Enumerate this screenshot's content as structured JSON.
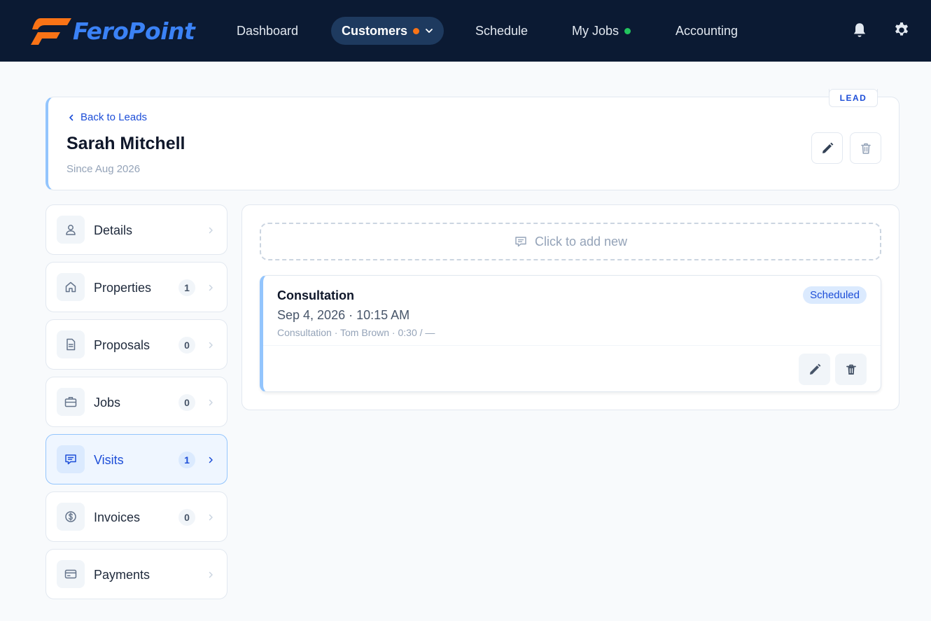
{
  "app": {
    "brand": "FeroPoint",
    "brand_colors": {
      "orange": "#f97316",
      "blue": "#3b82f6",
      "nav_bg": "#0b1a33"
    }
  },
  "nav": {
    "items": [
      {
        "label": "Dashboard",
        "active": false
      },
      {
        "label": "Customers",
        "active": true,
        "dot_color": "#f97316",
        "has_dropdown": true
      },
      {
        "label": "Schedule",
        "active": false
      },
      {
        "label": "My Jobs",
        "active": false,
        "dot_color": "#22c55e"
      },
      {
        "label": "Accounting",
        "active": false
      }
    ],
    "icons": [
      "bell-icon",
      "gear-icon"
    ]
  },
  "header": {
    "back_label": "Back to Leads",
    "name": "Sarah Mitchell",
    "since": "Since Aug 2026",
    "badge": "LEAD"
  },
  "sidebar": {
    "items": [
      {
        "label": "Details",
        "icon": "user-icon",
        "count": null,
        "active": false
      },
      {
        "label": "Properties",
        "icon": "home-icon",
        "count": "1",
        "active": false
      },
      {
        "label": "Proposals",
        "icon": "document-icon",
        "count": "0",
        "active": false
      },
      {
        "label": "Jobs",
        "icon": "briefcase-icon",
        "count": "0",
        "active": false
      },
      {
        "label": "Visits",
        "icon": "chat-icon",
        "count": "1",
        "active": true
      },
      {
        "label": "Invoices",
        "icon": "dollar-icon",
        "count": "0",
        "active": false
      },
      {
        "label": "Payments",
        "icon": "card-icon",
        "count": null,
        "active": false
      }
    ]
  },
  "main": {
    "add_new_label": "Click to add new",
    "visits": [
      {
        "title": "Consultation",
        "datetime": "Sep 4, 2026 · 10:15 AM",
        "meta": "Consultation · Tom Brown · 0:30 / —",
        "status": "Scheduled"
      }
    ]
  }
}
